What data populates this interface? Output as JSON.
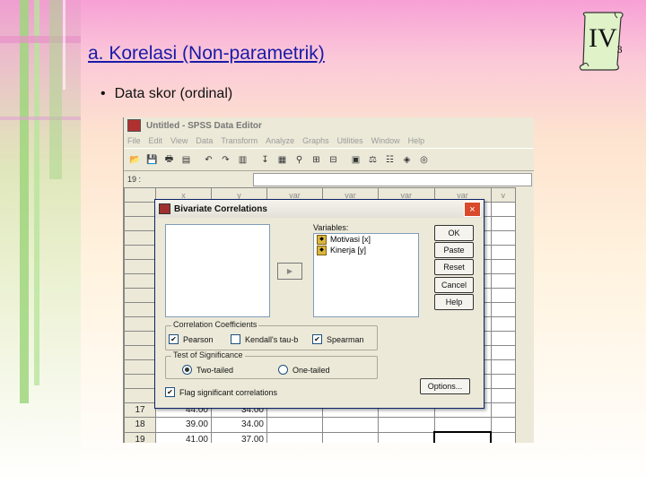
{
  "slide": {
    "title": "a.  Korelasi (Non-parametrik)",
    "bullet": "Data skor (ordinal)",
    "badge_main": "IV",
    "badge_sub": "3"
  },
  "spss": {
    "window_title": "Untitled - SPSS Data Editor",
    "menu": [
      "File",
      "Edit",
      "View",
      "Data",
      "Transform",
      "Analyze",
      "Graphs",
      "Utilities",
      "Window",
      "Help"
    ],
    "cell_ref": "19 :",
    "columns": [
      "x",
      "y",
      "var",
      "var",
      "var",
      "var",
      "v"
    ],
    "rows": [
      {
        "n": "17",
        "x": "44.00",
        "y": "34.00"
      },
      {
        "n": "18",
        "x": "39.00",
        "y": "34.00"
      },
      {
        "n": "19",
        "x": "41.00",
        "y": "37.00"
      }
    ],
    "toolbar_icons": [
      "open-icon",
      "save-icon",
      "print-icon",
      "dialog-recall-icon",
      "undo-icon",
      "redo-icon",
      "goto-chart-icon",
      "goto-case-icon",
      "variables-icon",
      "find-icon",
      "insert-case-icon",
      "insert-variable-icon",
      "split-file-icon",
      "weight-cases-icon",
      "select-cases-icon",
      "value-labels-icon",
      "use-sets-icon"
    ]
  },
  "dialog": {
    "title": "Bivariate Correlations",
    "close_label": "×",
    "variables_label": "Variables:",
    "variables": [
      "Motivasi [x]",
      "Kinerja [y]"
    ],
    "buttons": {
      "ok": "OK",
      "paste": "Paste",
      "reset": "Reset",
      "cancel": "Cancel",
      "help": "Help",
      "options": "Options..."
    },
    "coef_group": "Correlation Coefficients",
    "coefficients": [
      {
        "label": "Pearson",
        "checked": true
      },
      {
        "label": "Kendall's tau-b",
        "checked": false
      },
      {
        "label": "Spearman",
        "checked": true
      }
    ],
    "sig_group": "Test of Significance",
    "significance": [
      {
        "label": "Two-tailed",
        "selected": true
      },
      {
        "label": "One-tailed",
        "selected": false
      }
    ],
    "flag_label": "Flag significant correlations",
    "flag_checked": true
  }
}
